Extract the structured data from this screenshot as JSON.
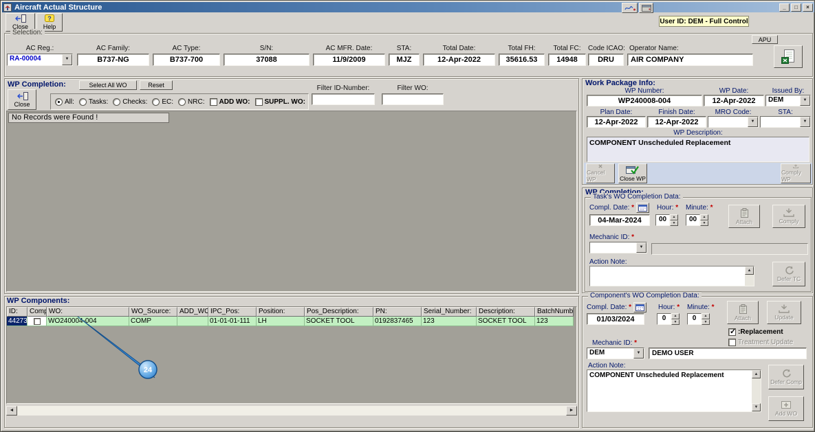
{
  "window": {
    "title": "Aircraft Actual Structure",
    "controls": {
      "minimize": "_",
      "maximize": "□",
      "close": "×"
    }
  },
  "toolbar": {
    "close_label": "Close",
    "help_label": "Help",
    "user_badge": "User ID: DEM - Full Control"
  },
  "selection": {
    "legend": "Selection:",
    "apu_label": "APU",
    "ac_reg_label": "AC Reg.:",
    "ac_reg_value": "RA-00004",
    "fields": [
      {
        "label": "AC Family:",
        "value": "B737-NG"
      },
      {
        "label": "AC Type:",
        "value": "B737-700"
      },
      {
        "label": "S/N:",
        "value": "37088"
      },
      {
        "label": "AC MFR. Date:",
        "value": "11/9/2009"
      },
      {
        "label": "STA:",
        "value": "MJZ"
      },
      {
        "label": "Total Date:",
        "value": "12-Apr-2022"
      },
      {
        "label": "Total FH:",
        "value": "35616.53"
      },
      {
        "label": "Total FC:",
        "value": "14948"
      },
      {
        "label": "Code ICAO:",
        "value": "DRU"
      },
      {
        "label": "Operator Name:",
        "value": "AIR COMPANY"
      }
    ]
  },
  "wp_list": {
    "title": "WP Completion:",
    "select_all_wo": "Select All WO",
    "reset": "Reset",
    "close_label": "Close",
    "radio_all": "All:",
    "radio_tasks": "Tasks:",
    "radio_checks": "Checks:",
    "radio_ec": "EC:",
    "radio_nrc": "NRC:",
    "add_wo": "ADD WO:",
    "suppl_wo": "SUPPL. WO:",
    "filter_id_label": "Filter ID-Number:",
    "filter_wo_label": "Filter WO:",
    "filter_id_value": "",
    "filter_wo_value": "",
    "no_records": "No Records were Found !"
  },
  "work_package": {
    "title": "Work Package Info:",
    "wp_number_label": "WP Number:",
    "wp_number": "WP240008-004",
    "wp_date_label": "WP Date:",
    "wp_date": "12-Apr-2022",
    "issued_by_label": "Issued By:",
    "issued_by": "DEM",
    "plan_date_label": "Plan Date:",
    "plan_date": "12-Apr-2022",
    "finish_date_label": "Finish Date:",
    "finish_date": "12-Apr-2022",
    "mro_code_label": "MRO Code:",
    "mro_code": "",
    "sta_label": "STA:",
    "sta": "",
    "description_label": "WP Description:",
    "description": "COMPONENT Unscheduled Replacement",
    "cancel_wp": "Cancel WP",
    "close_wp": "Close WP",
    "comply_wp": "Comply WP"
  },
  "task_completion": {
    "group_title": "WP Completion:",
    "title": "Task's WO Completion Data:",
    "compl_date_label": "Compl. Date:",
    "required": "*",
    "compl_date": "04-Mar-2024",
    "hour_label": "Hour:",
    "hour": "00",
    "minute_label": "Minute:",
    "minute": "00",
    "attach": "Attach",
    "comply": "Comply",
    "mechanic_label": "Mechanic ID:",
    "mechanic_id": "",
    "mechanic_name": "",
    "action_note_label": "Action Note:",
    "action_note": "",
    "defer_tc": "Defer TC"
  },
  "component_completion": {
    "title": "Component's WO Completion Data:",
    "compl_date_label": "Compl. Date:",
    "required": "*",
    "compl_date": "01/03/2024",
    "hour_label": "Hour:",
    "hour": "0",
    "minute_label": "Minute:",
    "minute": "0",
    "attach": "Attach",
    "update": "Update",
    "replacement": ":Replacement",
    "treatment_update": "Treatment Update",
    "mechanic_label": "Mechanic ID:",
    "mechanic_id": "DEM",
    "mechanic_name": "DEMO USER",
    "action_note_label": "Action Note:",
    "action_note": "COMPONENT Unscheduled Replacement",
    "defer_comp": "Defer Comp",
    "add_wo": "Add WO"
  },
  "components_table": {
    "title": "WP Components:",
    "columns": [
      "ID:",
      "Comply:",
      "WO:",
      "WO_Source:",
      "ADD_WO:",
      "IPC_Pos:",
      "Position:",
      "Pos_Description:",
      "PN:",
      "Serial_Number:",
      "Description:",
      "BatchNumber"
    ],
    "row": {
      "id": "44273",
      "wo": "WO240004-004",
      "wo_source": "COMP",
      "add_wo": "",
      "ipc_pos": "01-01-01-111",
      "position": "LH",
      "pos_description": "SOCKET TOOL",
      "pn": "0192837465",
      "serial_number": "123",
      "description": "SOCKET TOOL",
      "batch_number": "123"
    },
    "annotation_number": "24"
  },
  "colors": {
    "selection_blue": "#0a246a",
    "row_green": "#c2f0c2",
    "badge_yellow": "#ffffcc",
    "annotation_blue": "#3186d6"
  }
}
